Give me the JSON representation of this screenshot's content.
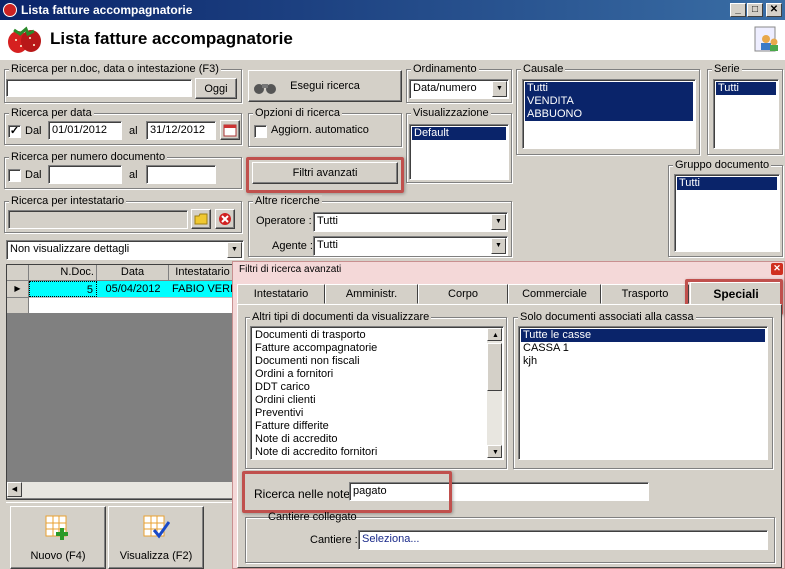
{
  "window": {
    "title": "Lista fatture accompagnatorie"
  },
  "header": {
    "title": "Lista fatture accompagnatorie"
  },
  "search_doc": {
    "legend": "Ricerca per n.doc, data o intestazione (F3)",
    "value": "",
    "today_button": "Oggi"
  },
  "run_search": {
    "label": "Esegui ricerca"
  },
  "ordinamento": {
    "legend": "Ordinamento",
    "value": "Data/numero"
  },
  "causale": {
    "legend": "Causale",
    "items": [
      "Tutti",
      "VENDITA",
      "ABBUONO"
    ]
  },
  "serie": {
    "legend": "Serie",
    "items": [
      "Tutti"
    ]
  },
  "date_search": {
    "legend": "Ricerca per data",
    "from_label": "Dal",
    "from_value": "01/01/2012",
    "to_label": "al",
    "to_value": "31/12/2012"
  },
  "search_options": {
    "legend": "Opzioni di ricerca",
    "auto_update": "Aggiorn. automatico"
  },
  "visualizzazione": {
    "legend": "Visualizzazione",
    "items": [
      "Default"
    ]
  },
  "number_search": {
    "legend": "Ricerca per numero documento",
    "from_label": "Dal",
    "to_label": "al"
  },
  "advanced_filters_button": {
    "label": "Filtri avanzati"
  },
  "gruppo": {
    "legend": "Gruppo documento",
    "items": [
      "Tutti"
    ]
  },
  "holder_search": {
    "legend": "Ricerca per intestatario"
  },
  "other_searches": {
    "legend": "Altre ricerche",
    "operator_label": "Operatore :",
    "operator_value": "Tutti",
    "agent_label": "Agente :",
    "agent_value": "Tutti"
  },
  "details_select": {
    "value": "Non visualizzare dettagli"
  },
  "grid": {
    "columns": [
      "N.Doc.",
      "Data",
      "Intestatario"
    ],
    "rows": [
      {
        "num": "5",
        "date": "05/04/2012",
        "holder": "FABIO VERD"
      }
    ]
  },
  "bottom_buttons": {
    "new": "Nuovo (F4)",
    "view": "Visualizza (F2)"
  },
  "advanced_panel": {
    "title": "Filtri di ricerca avanzati",
    "tabs": [
      "Intestatario",
      "Amministr.",
      "Corpo",
      "Commerciale",
      "Trasporto",
      "Speciali"
    ],
    "other_types_legend": "Altri tipi di documenti da visualizzare",
    "other_types": [
      "Documenti di trasporto",
      "Fatture accompagnatorie",
      "Documenti non fiscali",
      "Ordini a fornitori",
      "DDT carico",
      "Ordini clienti",
      "Preventivi",
      "Fatture differite",
      "Note di accredito",
      "Note di accredito fornitori"
    ],
    "cash_legend": "Solo documenti associati alla cassa",
    "cash_items": [
      "Tutte le casse",
      "CASSA 1",
      "kjh"
    ],
    "notes_label": "Ricerca nelle note",
    "notes_value": "pagato",
    "site_legend": "Cantiere collegato",
    "site_label": "Cantiere :",
    "site_value": "Seleziona..."
  },
  "colors": {
    "selection": "#0a246a",
    "highlight": "#c0504d",
    "panel_bg": "#f4d8d8"
  }
}
